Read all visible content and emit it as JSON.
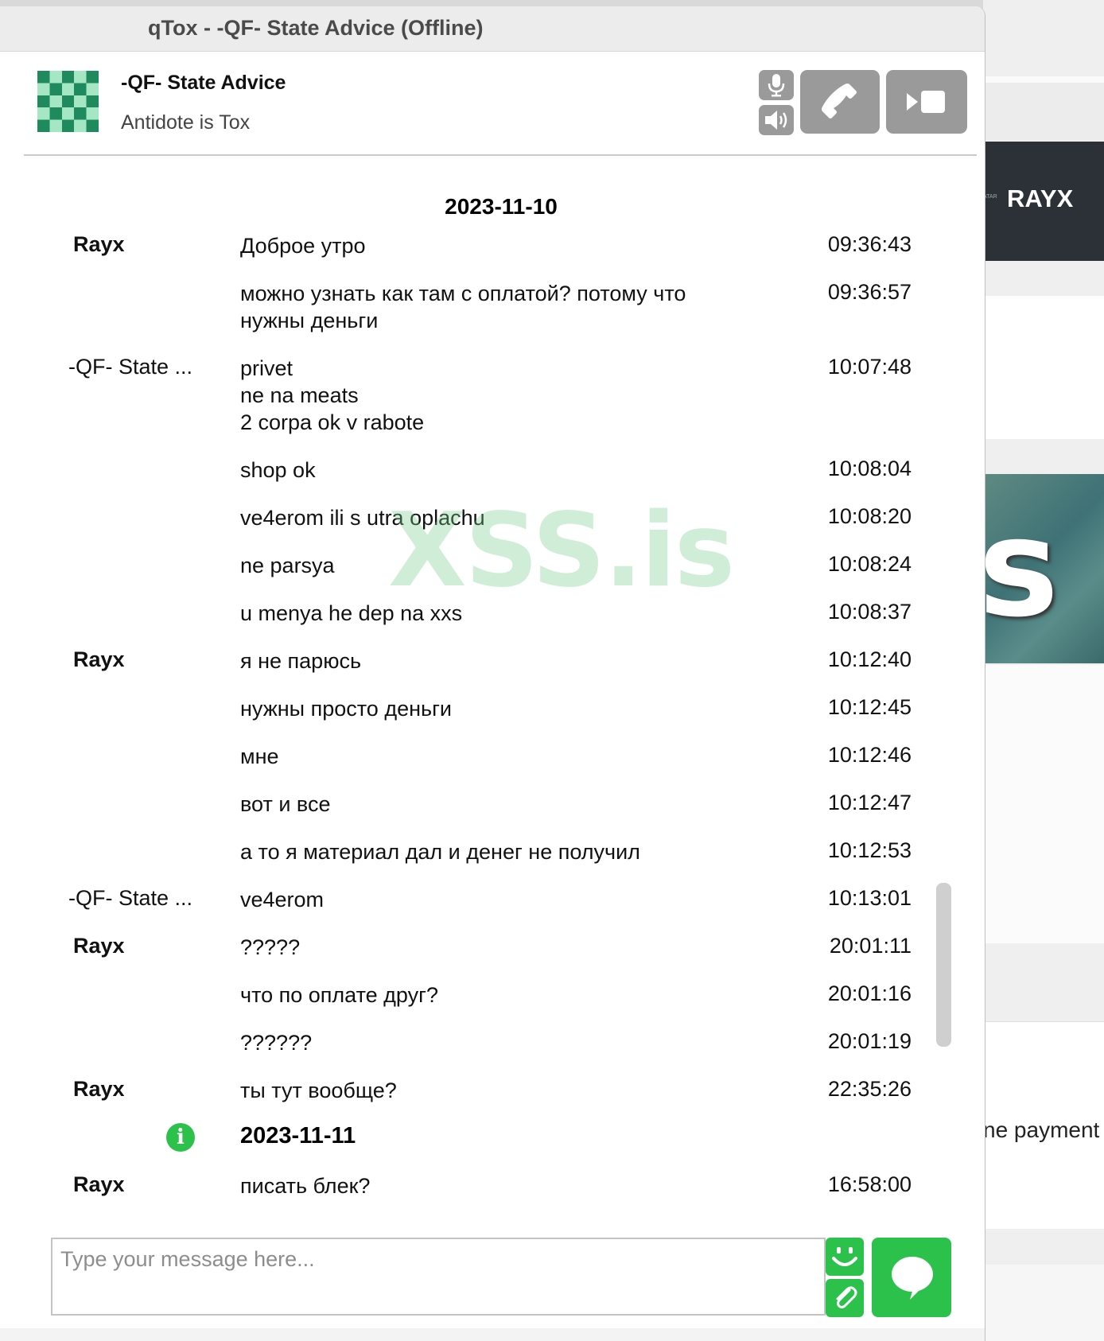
{
  "window": {
    "title": "qTox - -QF- State Advice (Offline)"
  },
  "contact": {
    "name": "-QF- State Advice",
    "status_message": "Antidote is Tox"
  },
  "call_controls": {
    "mic_icon": "microphone-icon",
    "volume_icon": "speaker-icon",
    "call_icon": "phone-icon",
    "video_icon": "video-icon"
  },
  "chat": {
    "date_header": "2023-11-10",
    "messages": [
      {
        "author": "Rayx",
        "text": "Доброе утро",
        "time": "09:36:43"
      },
      {
        "author": "",
        "text": "можно узнать как там с оплатой? потому что\nнужны деньги",
        "time": "09:36:57"
      },
      {
        "author": "-QF- State ...",
        "text": "privet\nne na meats\n2 corpa ok v rabote",
        "time": "10:07:48"
      },
      {
        "author": "",
        "text": "shop ok",
        "time": "10:08:04"
      },
      {
        "author": "",
        "text": "ve4erom ili s utra oplachu",
        "time": "10:08:20"
      },
      {
        "author": "",
        "text": "ne parsya",
        "time": "10:08:24"
      },
      {
        "author": "",
        "text": "u menya he dep na xxs",
        "time": "10:08:37"
      },
      {
        "author": "Rayx",
        "text": "я не парюсь",
        "time": "10:12:40"
      },
      {
        "author": "",
        "text": "нужны просто деньги",
        "time": "10:12:45"
      },
      {
        "author": "",
        "text": "мне",
        "time": "10:12:46"
      },
      {
        "author": "",
        "text": "вот и все",
        "time": "10:12:47"
      },
      {
        "author": "",
        "text": "а то я материал дал и денег не получил",
        "time": "10:12:53"
      },
      {
        "author": "-QF- State ...",
        "text": "ve4erom",
        "time": "10:13:01"
      },
      {
        "author": "Rayx",
        "text": "?????",
        "time": "20:01:11"
      },
      {
        "author": "",
        "text": "что по оплате друг?",
        "time": "20:01:16"
      },
      {
        "author": "",
        "text": "??????",
        "time": "20:01:19"
      },
      {
        "author": "Rayx",
        "text": "ты тут вообще?",
        "time": "22:35:26"
      }
    ],
    "date_separator": "2023-11-11",
    "info_icon": "info-icon",
    "last_message": {
      "author": "Rayx",
      "text": "писать блек?",
      "time": "16:58:00"
    }
  },
  "watermark": "XSS.is",
  "composer": {
    "placeholder": "Type your message here...",
    "emoji_icon": "smiley-icon",
    "attach_icon": "paperclip-icon",
    "send_icon": "speech-bubble-icon"
  },
  "background_page": {
    "banner_text": "RAYX",
    "tiny_text": "ATAR",
    "partial_text": "ne payment"
  },
  "colors": {
    "accent_green": "#2cc14a",
    "button_gray": "#9a9a9a",
    "avatar_dark": "#1e8a5e",
    "avatar_light": "#a5e6c3"
  }
}
